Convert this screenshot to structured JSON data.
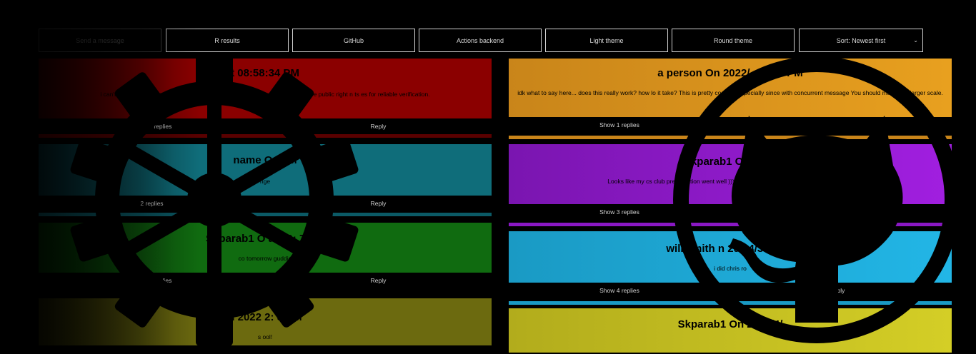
{
  "toolbar": {
    "send_message": "Send a message",
    "refresh_results": "R      results",
    "github": "GitHub",
    "actions_backend": "Actions backend",
    "light_theme": "Light theme",
    "round_theme": "Round theme",
    "sort": "Sort: Newest first"
  },
  "left_posts": [
    {
      "heading": "t 08:58:34 PM",
      "text": "i can't  p       original messa           the database is open so i can't store any \"key\" that isn't  e       public right n        ts        es for reliable verification.",
      "show_replies": "Show 1 replies",
      "reply": "Reply",
      "color": "#8b0000"
    },
    {
      "heading": "name    O                       0:       M",
      "text": "nge",
      "show_replies": "2 replies",
      "reply": "Reply",
      "color": "#0f6d7a"
    },
    {
      "heading": "Skparab1    O            at 09:     7 PM",
      "text": "co                  tomorrow                         guddie",
      "show_replies": "Show 4 replies",
      "reply": "Reply",
      "color": "#106b10"
    },
    {
      "heading": "n 2022           2:      5 PM",
      "text": "s        ool!",
      "show_replies": "",
      "reply": "",
      "color": "#6c6a0f"
    }
  ],
  "right_posts": [
    {
      "heading": "a person    On 2022/        :56:48 PM",
      "text": "idk what to say here... does this really work? how lo      it take? This is pretty cool ngl especially since         with concurrent message          You should make this larger scale.",
      "show_replies": "Show 1 replies",
      "reply": "",
      "color": "#e39a1f"
    },
    {
      "heading": "Skparab1    On 2022",
      "text": "Looks like my cs club presentation went well       )))) XD But              for production apps. B       s interesting",
      "show_replies": "Show 3 replies",
      "reply": "",
      "color": "#a11fe0"
    },
    {
      "heading": "will smith     n 202  4/3 at 09:",
      "text": "i did       chris ro",
      "show_replies": "Show 4 replies",
      "reply": "ply",
      "color": "#1fb0e0"
    },
    {
      "heading": "Skparab1    On 2022/4/",
      "text": "",
      "show_replies": "",
      "reply": "",
      "color": "#d2cc24"
    }
  ],
  "icons": {
    "left_overlay": "gear-icon",
    "right_overlay": "github-logo-icon"
  }
}
